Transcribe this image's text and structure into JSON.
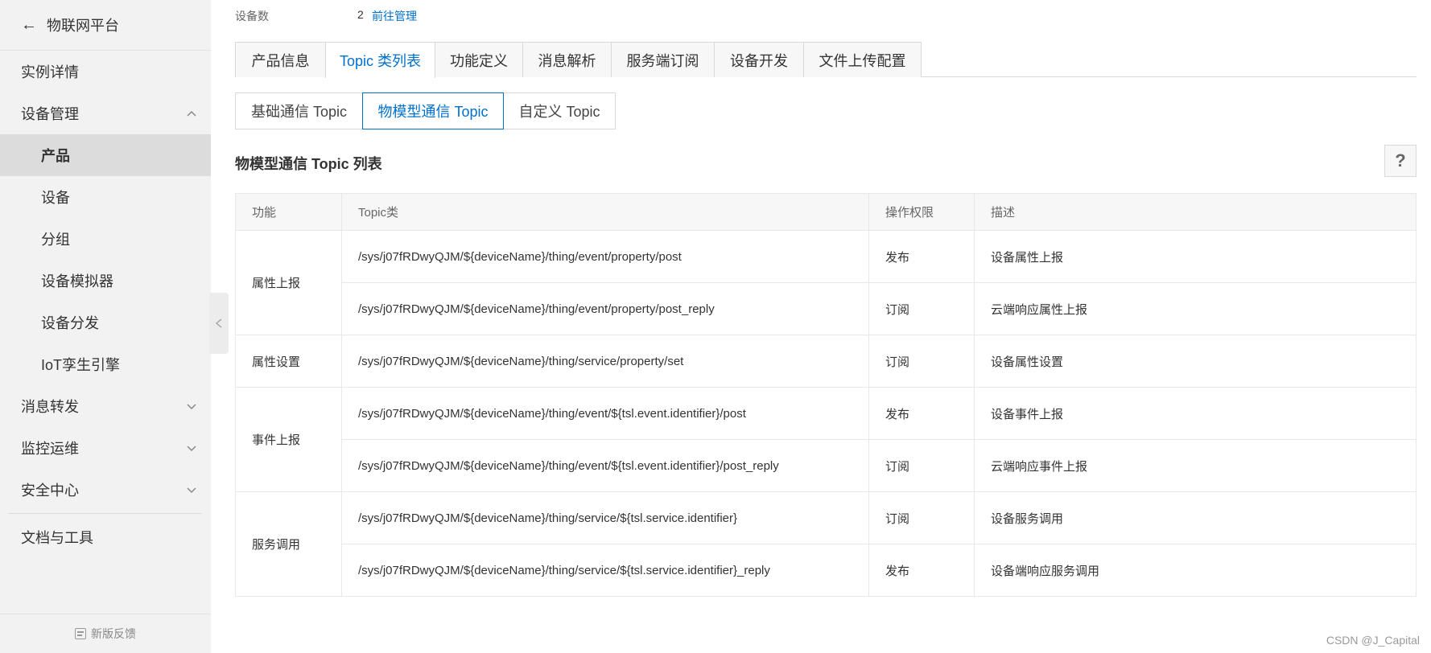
{
  "sidebar": {
    "back_icon": "arrow-left-icon",
    "title": "物联网平台",
    "items": [
      {
        "label": "实例详情"
      },
      {
        "label": "设备管理",
        "expanded": true
      },
      {
        "label": "产品",
        "active": true
      },
      {
        "label": "设备"
      },
      {
        "label": "分组"
      },
      {
        "label": "设备模拟器"
      },
      {
        "label": "设备分发"
      },
      {
        "label": "IoT孪生引擎"
      },
      {
        "label": "消息转发"
      },
      {
        "label": "监控运维"
      },
      {
        "label": "安全中心"
      },
      {
        "label": "文档与工具"
      }
    ],
    "footer": "新版反馈"
  },
  "device_count": {
    "label": "设备数",
    "value": "2",
    "link": "前往管理"
  },
  "tabs": [
    {
      "label": "产品信息"
    },
    {
      "label": "Topic 类列表",
      "active": true
    },
    {
      "label": "功能定义"
    },
    {
      "label": "消息解析"
    },
    {
      "label": "服务端订阅"
    },
    {
      "label": "设备开发"
    },
    {
      "label": "文件上传配置"
    }
  ],
  "subtabs": [
    {
      "label": "基础通信 Topic"
    },
    {
      "label": "物模型通信 Topic",
      "active": true
    },
    {
      "label": "自定义 Topic"
    }
  ],
  "section_title": "物模型通信 Topic 列表",
  "help_label": "?",
  "table": {
    "headers": [
      "功能",
      "Topic类",
      "操作权限",
      "描述"
    ],
    "groups": [
      {
        "func": "属性上报",
        "rows": [
          {
            "topic": "/sys/j07fRDwyQJM/${deviceName}/thing/event/property/post",
            "perm": "发布",
            "desc": "设备属性上报"
          },
          {
            "topic": "/sys/j07fRDwyQJM/${deviceName}/thing/event/property/post_reply",
            "perm": "订阅",
            "desc": "云端响应属性上报"
          }
        ]
      },
      {
        "func": "属性设置",
        "rows": [
          {
            "topic": "/sys/j07fRDwyQJM/${deviceName}/thing/service/property/set",
            "perm": "订阅",
            "desc": "设备属性设置"
          }
        ]
      },
      {
        "func": "事件上报",
        "rows": [
          {
            "topic": "/sys/j07fRDwyQJM/${deviceName}/thing/event/${tsl.event.identifier}/post",
            "perm": "发布",
            "desc": "设备事件上报"
          },
          {
            "topic": "/sys/j07fRDwyQJM/${deviceName}/thing/event/${tsl.event.identifier}/post_reply",
            "perm": "订阅",
            "desc": "云端响应事件上报"
          }
        ]
      },
      {
        "func": "服务调用",
        "rows": [
          {
            "topic": "/sys/j07fRDwyQJM/${deviceName}/thing/service/${tsl.service.identifier}",
            "perm": "订阅",
            "desc": "设备服务调用"
          },
          {
            "topic": "/sys/j07fRDwyQJM/${deviceName}/thing/service/${tsl.service.identifier}_reply",
            "perm": "发布",
            "desc": "设备端响应服务调用"
          }
        ]
      }
    ]
  },
  "watermark": "CSDN @J_Capital"
}
